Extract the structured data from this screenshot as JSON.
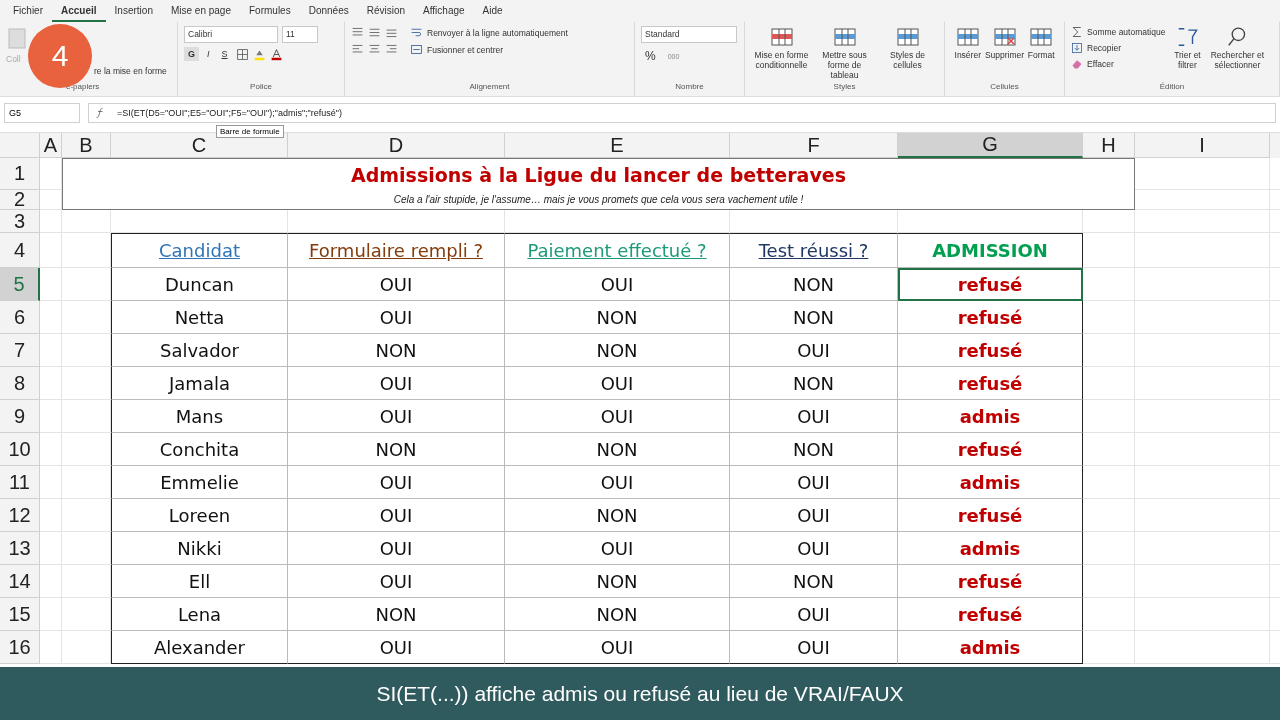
{
  "menu_tabs": [
    {
      "label": "Fichier",
      "selected": false
    },
    {
      "label": "Accueil",
      "selected": true
    },
    {
      "label": "Insertion",
      "selected": false
    },
    {
      "label": "Mise en page",
      "selected": false
    },
    {
      "label": "Formules",
      "selected": false
    },
    {
      "label": "Données",
      "selected": false
    },
    {
      "label": "Révision",
      "selected": false
    },
    {
      "label": "Affichage",
      "selected": false
    },
    {
      "label": "Aide",
      "selected": false
    }
  ],
  "ribbon": {
    "clipboard": {
      "paste": "Coll",
      "format_painter": "re la mise en forme",
      "label": "e-papiers"
    },
    "font": {
      "font_name": "Calibri",
      "font_size": "11",
      "bold": "G",
      "italic": "I",
      "underline": "S",
      "label": "Police"
    },
    "alignment": {
      "wrap": "Renvoyer à la ligne automatiquement",
      "merge": "Fusionner et centrer",
      "label": "Alignement"
    },
    "number": {
      "format": "Standard",
      "percent": "%",
      "thousands": "000",
      "label": "Nombre"
    },
    "styles": {
      "buttons": [
        {
          "label": "Mise en forme conditionnelle",
          "kind": "conditional"
        },
        {
          "label": "Mettre sous forme de tableau",
          "kind": "table"
        },
        {
          "label": "Styles de cellules",
          "kind": "cellstyle"
        }
      ],
      "label": "Styles"
    },
    "cells": {
      "buttons": [
        {
          "label": "Insérer",
          "kind": "insert"
        },
        {
          "label": "Supprimer",
          "kind": "delete"
        },
        {
          "label": "Format",
          "kind": "format"
        }
      ],
      "label": "Cellules"
    },
    "editing": {
      "items": [
        {
          "label": "Somme automatique",
          "kind": "sum"
        },
        {
          "label": "Recopier",
          "kind": "fill"
        },
        {
          "label": "Effacer",
          "kind": "clear"
        }
      ],
      "sort": "Trier et filtrer",
      "find": "Rechercher et sélectionner",
      "label": "Édition"
    }
  },
  "formula_bar": {
    "name_box": "G5",
    "formula": "=SI(ET(D5=\"OUI\";E5=\"OUI\";F5=\"OUI\");\"admis\";\"refusé\")",
    "tooltip": "Barre de formule"
  },
  "columns": [
    {
      "label": "A",
      "selected": false
    },
    {
      "label": "B",
      "selected": false
    },
    {
      "label": "C",
      "selected": false
    },
    {
      "label": "D",
      "selected": false
    },
    {
      "label": "E",
      "selected": false
    },
    {
      "label": "F",
      "selected": false
    },
    {
      "label": "G",
      "selected": true
    },
    {
      "label": "H",
      "selected": false
    },
    {
      "label": "I",
      "selected": false
    }
  ],
  "row_numbers": [
    {
      "label": "1",
      "selected": false
    },
    {
      "label": "2",
      "selected": false
    },
    {
      "label": "3",
      "selected": false
    },
    {
      "label": "4",
      "selected": false
    },
    {
      "label": "5",
      "selected": true
    },
    {
      "label": "6",
      "selected": false
    },
    {
      "label": "7",
      "selected": false
    },
    {
      "label": "8",
      "selected": false
    },
    {
      "label": "9",
      "selected": false
    },
    {
      "label": "10",
      "selected": false
    },
    {
      "label": "11",
      "selected": false
    },
    {
      "label": "12",
      "selected": false
    },
    {
      "label": "13",
      "selected": false
    },
    {
      "label": "14",
      "selected": false
    },
    {
      "label": "15",
      "selected": false
    },
    {
      "label": "16",
      "selected": false
    }
  ],
  "sheet": {
    "title": "Admissions à la Ligue du lancer de betteraves",
    "subtitle": "Cela a l'air stupide, je l'assume… mais je vous promets que cela vous sera vachement utile !",
    "headers": [
      {
        "label": "Candidat",
        "color": "#2e75b6"
      },
      {
        "label": "Formulaire rempli ?",
        "color": "#843c0c"
      },
      {
        "label": "Paiement effectué ?",
        "color": "#1e9a7a"
      },
      {
        "label": "Test réussi ?",
        "color": "#1f3864"
      },
      {
        "label": "ADMISSION",
        "color": "#00a050"
      }
    ],
    "rows": [
      {
        "cells": [
          "Duncan",
          "OUI",
          "OUI",
          "NON",
          "refusé"
        ],
        "selected": true
      },
      {
        "cells": [
          "Netta",
          "OUI",
          "NON",
          "NON",
          "refusé"
        ],
        "selected": false
      },
      {
        "cells": [
          "Salvador",
          "NON",
          "NON",
          "OUI",
          "refusé"
        ],
        "selected": false
      },
      {
        "cells": [
          "Jamala",
          "OUI",
          "OUI",
          "NON",
          "refusé"
        ],
        "selected": false
      },
      {
        "cells": [
          "Mans",
          "OUI",
          "OUI",
          "OUI",
          "admis"
        ],
        "selected": false
      },
      {
        "cells": [
          "Conchita",
          "NON",
          "NON",
          "NON",
          "refusé"
        ],
        "selected": false
      },
      {
        "cells": [
          "Emmelie",
          "OUI",
          "OUI",
          "OUI",
          "admis"
        ],
        "selected": false
      },
      {
        "cells": [
          "Loreen",
          "OUI",
          "NON",
          "OUI",
          "refusé"
        ],
        "selected": false
      },
      {
        "cells": [
          "Nikki",
          "OUI",
          "OUI",
          "OUI",
          "admis"
        ],
        "selected": false
      },
      {
        "cells": [
          "Ell",
          "OUI",
          "NON",
          "NON",
          "refusé"
        ],
        "selected": false
      },
      {
        "cells": [
          "Lena",
          "NON",
          "NON",
          "OUI",
          "refusé"
        ],
        "selected": false
      },
      {
        "cells": [
          "Alexander",
          "OUI",
          "OUI",
          "OUI",
          "admis"
        ],
        "selected": false
      }
    ]
  },
  "step_badge": "4",
  "caption": "SI(ET(...)) affiche admis ou refusé au lieu de VRAI/FAUX"
}
